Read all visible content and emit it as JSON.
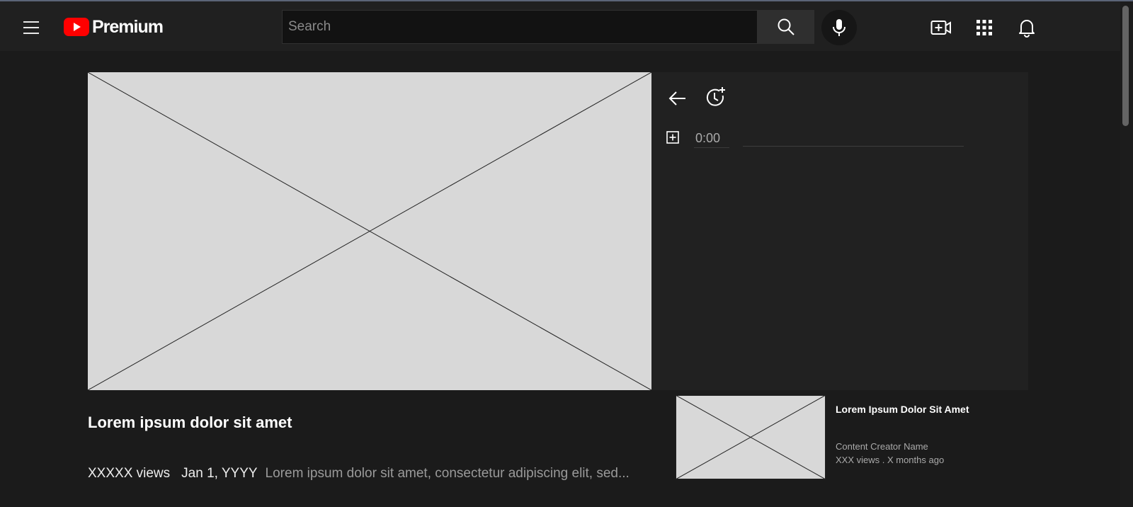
{
  "header": {
    "logo_text": "Premium",
    "search": {
      "placeholder": "Search",
      "value": ""
    },
    "icons": [
      "menu-icon",
      "search-icon",
      "mic-icon",
      "create-video-icon",
      "apps-grid-icon",
      "bell-icon"
    ]
  },
  "colors": {
    "brand_red": "#ff0000",
    "background": "#1b1b1b",
    "header": "#202020",
    "panel": "#212121",
    "placeholder": "#d8d8d8"
  },
  "side_panel": {
    "icons": [
      "back-arrow-icon",
      "add-timestamp-icon",
      "add-box-icon"
    ],
    "time_value": "0:00"
  },
  "video": {
    "title": "Lorem ipsum dolor sit amet",
    "views": "XXXXX views",
    "date": "Jan 1, YYYY",
    "description": "Lorem ipsum dolor sit amet, consectetur adipiscing elit, sed..."
  },
  "recommendation": {
    "title": "Lorem Ipsum Dolor Sit Amet",
    "channel": "Content Creator Name",
    "stats": "XXX views . X months ago"
  }
}
